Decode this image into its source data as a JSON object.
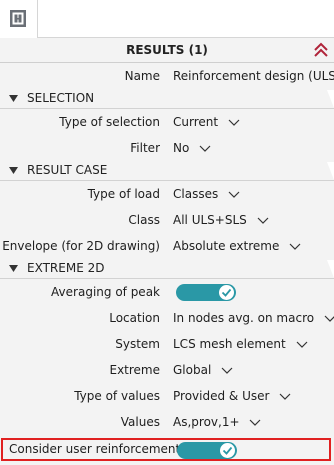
{
  "panel": {
    "title": "RESULTS (1)",
    "name_label": "Name",
    "name_value": "Reinforcement design (ULS+"
  },
  "sections": {
    "selection": {
      "title": "SELECTION",
      "rows": [
        {
          "label": "Type of selection",
          "value": "Current"
        },
        {
          "label": "Filter",
          "value": "No"
        }
      ]
    },
    "result_case": {
      "title": "RESULT CASE",
      "rows": [
        {
          "label": "Type of load",
          "value": "Classes"
        },
        {
          "label": "Class",
          "value": "All ULS+SLS"
        },
        {
          "label": "Envelope (for 2D drawing)",
          "value": "Absolute extreme"
        }
      ]
    },
    "extreme_2d": {
      "title": "EXTREME 2D",
      "averaging_label": "Averaging of peak",
      "averaging_on": true,
      "rows": [
        {
          "label": "Location",
          "value": "In nodes avg. on macro"
        },
        {
          "label": "System",
          "value": "LCS mesh element"
        },
        {
          "label": "Extreme",
          "value": "Global"
        },
        {
          "label": "Type of values",
          "value": "Provided & User"
        },
        {
          "label": "Values",
          "value": "As,prov,1+"
        }
      ],
      "user_reinf_label": "Consider user reinforcement",
      "user_reinf_on": true
    }
  },
  "icons": {
    "app": "app-logo-icon",
    "collapse": "double-chevron-up-icon",
    "dropdown": "chevron-down-icon",
    "section_toggle": "triangle-down-icon",
    "toggle_check": "check-icon"
  },
  "colors": {
    "toggle": "#2a98a6",
    "highlight": "#e02020",
    "collapse_icon": "#b0243a"
  }
}
